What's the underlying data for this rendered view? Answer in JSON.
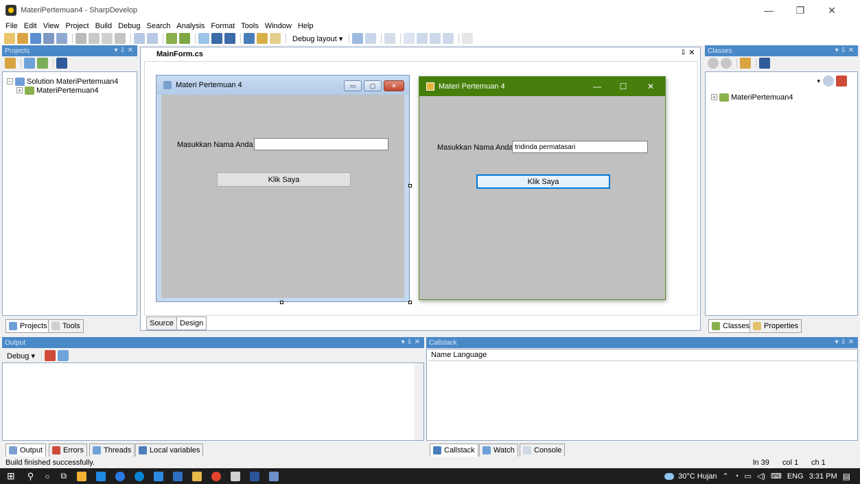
{
  "window": {
    "title": "MateriPertemuan4 - SharpDevelop"
  },
  "menu": [
    "File",
    "Edit",
    "View",
    "Project",
    "Build",
    "Debug",
    "Search",
    "Analysis",
    "Format",
    "Tools",
    "Window",
    "Help"
  ],
  "toolbar": {
    "debug_layout": "Debug layout ▾"
  },
  "projects": {
    "title": "Projects",
    "controls": "▾ ⇩ ✕",
    "solution": "Solution MateriPertemuan4",
    "project": "MateriPertemuan4",
    "tabs": [
      "Projects",
      "Tools"
    ]
  },
  "editor": {
    "tab": "MainForm.cs",
    "tab_controls": "⇩ ✕",
    "bottom_tabs": [
      "Source",
      "Design"
    ]
  },
  "form_designer": {
    "title": "Materi Pertemuan 4",
    "label": "Masukkan Nama Anda",
    "textbox_value": "",
    "button": "Klik Saya"
  },
  "form_running": {
    "title": "Materi Pertemuan 4",
    "label": "Masukkan Nama Anda",
    "textbox_value": "tridinda permatasari",
    "button": "Klik Saya",
    "controls": {
      "minimize": "—",
      "maximize": "☐",
      "close": "✕"
    }
  },
  "classes": {
    "title": "Classes",
    "controls": "▾ ⇩ ✕",
    "project": "MateriPertemuan4",
    "tabs": [
      "Classes",
      "Properties"
    ]
  },
  "output": {
    "title": "Output",
    "controls": "▾ ⇩ ✕",
    "dropdown": "Debug ▾",
    "tabs": [
      "Output",
      "Errors",
      "Threads",
      "Local variables"
    ]
  },
  "callstack": {
    "title": "Callstack",
    "controls": "▾ ⇩ ✕",
    "columns": [
      "Name",
      "Language"
    ],
    "tabs": [
      "Callstack",
      "Watch",
      "Console"
    ]
  },
  "status": {
    "message": "Build finished successfully.",
    "line": "ln 39",
    "col": "col 1",
    "ch": "ch 1"
  },
  "taskbar": {
    "weather": "30°C  Hujan",
    "lang": "ENG",
    "time": "3:31 PM"
  }
}
